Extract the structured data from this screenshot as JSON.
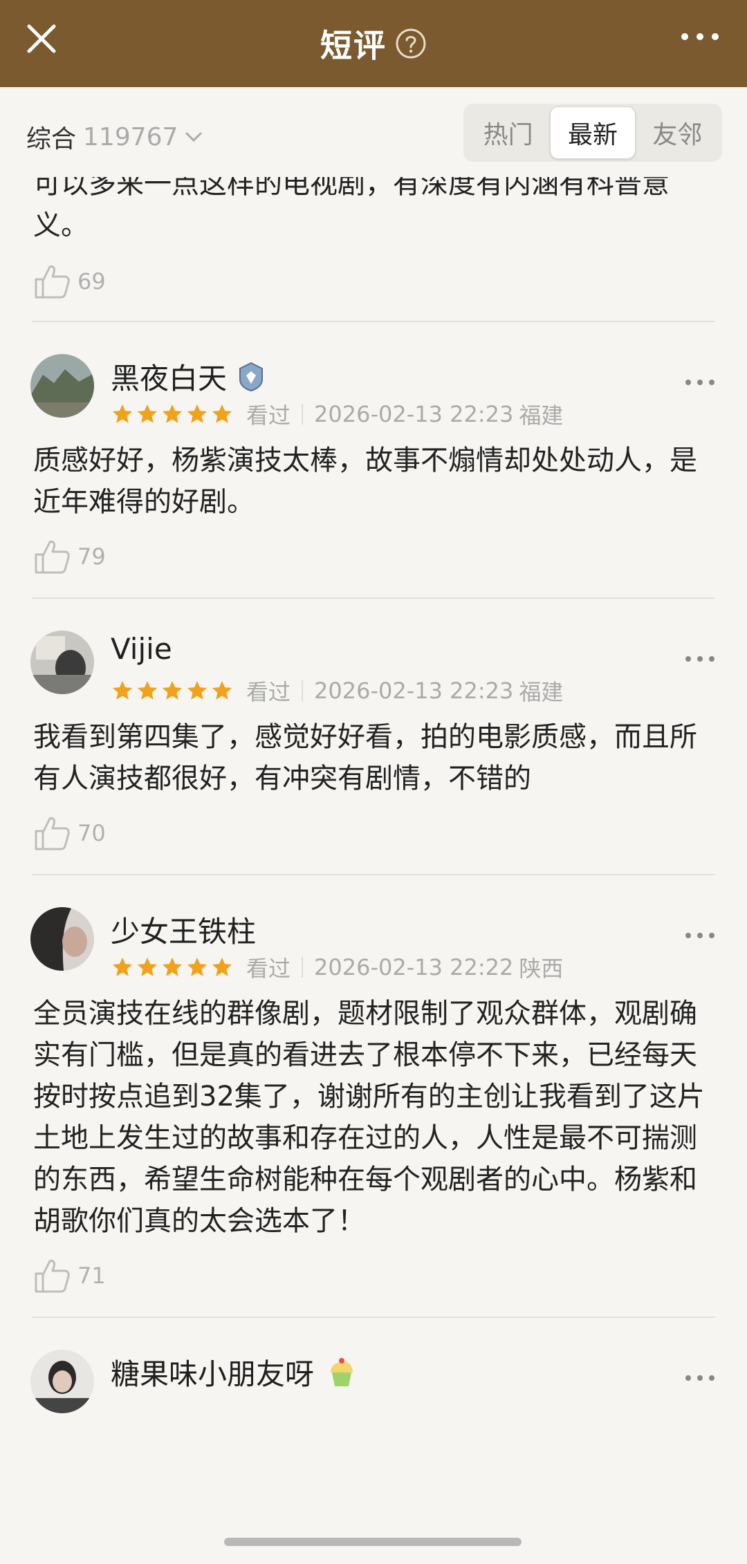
{
  "header": {
    "title": "短评",
    "help_icon": "help-circle-icon",
    "close_icon": "close-icon",
    "more_icon": "more-horizontal-icon",
    "bg_color": "#7a5a2e"
  },
  "filter": {
    "sort_label": "综合",
    "count": "119767",
    "tabs": [
      {
        "label": "热门",
        "active": false
      },
      {
        "label": "最新",
        "active": true
      },
      {
        "label": "友邻",
        "active": false
      }
    ]
  },
  "top_partial": {
    "text": "可以多来一点这样的电视剧，有深度有内涵有科普意义。",
    "likes": "69"
  },
  "reviews": [
    {
      "name": "黑夜白天",
      "badge": "badge-icon",
      "status": "看过",
      "date": "2026-02-13 22:23",
      "location": "福建",
      "stars": 5,
      "text": "质感好好，杨紫演技太棒，故事不煽情却处处动人，是近年难得的好剧。",
      "likes": "79"
    },
    {
      "name": "Vijie",
      "status": "看过",
      "date": "2026-02-13 22:23",
      "location": "福建",
      "stars": 5,
      "text": "我看到第四集了，感觉好好看，拍的电影质感，而且所有人演技都很好，有冲突有剧情，不错的",
      "likes": "70"
    },
    {
      "name": "少女王铁柱",
      "status": "看过",
      "date": "2026-02-13 22:22",
      "location": "陕西",
      "stars": 5,
      "text": "全员演技在线的群像剧，题材限制了观众群体，观剧确实有门槛，但是真的看进去了根本停不下来，已经每天按时按点追到32集了，谢谢所有的主创让我看到了这片土地上发生过的故事和存在过的人，人性是最不可揣测的东西，希望生命树能种在每个观剧者的心中。杨紫和胡歌你们真的太会选本了！",
      "likes": "71"
    },
    {
      "name": "糖果味小朋友呀",
      "badge": "cupcake-icon"
    }
  ]
}
